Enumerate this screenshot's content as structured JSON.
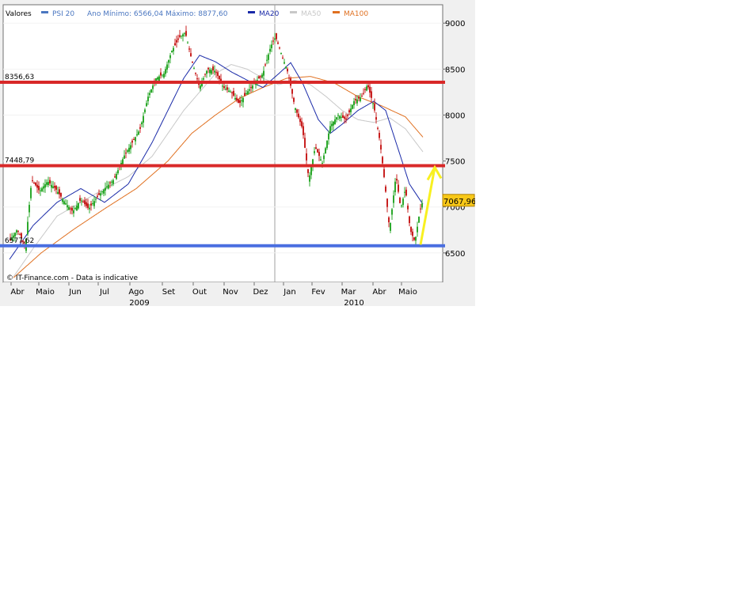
{
  "chart_data": {
    "type": "candlestick",
    "legend": {
      "values_label": "Valores",
      "items": [
        {
          "name": "PSI 20",
          "color": "#4a76c0"
        },
        {
          "name": "Ano Mínimo: 6566,04 Máximo: 8877,60",
          "color": null
        },
        {
          "name": "MA20",
          "color": "#1a2aa8"
        },
        {
          "name": "MA50",
          "color": "#c8c8c8"
        },
        {
          "name": "MA100",
          "color": "#e07020"
        }
      ]
    },
    "x_ticks": [
      "Abr",
      "Maio",
      "Jun",
      "Jul",
      "Ago",
      "Set",
      "Out",
      "Nov",
      "Dez",
      "Jan",
      "Fev",
      "Mar",
      "Abr",
      "Maio"
    ],
    "years": [
      "2009",
      "2010"
    ],
    "y_ticks": [
      6500,
      7000,
      7500,
      8000,
      8500,
      9000
    ],
    "y_range": [
      6180,
      9200
    ],
    "current_value_label": "7067,96",
    "current_value": 7067.96,
    "level_lines": [
      {
        "label": "8356,63",
        "value": 8356.63,
        "color": "#d82828"
      },
      {
        "label": "7448,79",
        "value": 7448.79,
        "color": "#d82828"
      },
      {
        "label": "6577,62",
        "value": 6577.62,
        "color": "#4a6ee0"
      }
    ],
    "arrow": {
      "from_value": 6590,
      "to_value": 7448.79,
      "color": "#f8f020"
    },
    "copyright": "© IT-Finance.com - Data is indicative",
    "anchors": [
      [
        0,
        6620
      ],
      [
        10,
        6760
      ],
      [
        20,
        6560
      ],
      [
        28,
        7300
      ],
      [
        38,
        7170
      ],
      [
        48,
        7280
      ],
      [
        58,
        7200
      ],
      [
        70,
        7050
      ],
      [
        80,
        6950
      ],
      [
        90,
        7080
      ],
      [
        100,
        6980
      ],
      [
        110,
        7100
      ],
      [
        120,
        7200
      ],
      [
        132,
        7300
      ],
      [
        145,
        7560
      ],
      [
        155,
        7700
      ],
      [
        165,
        7850
      ],
      [
        175,
        8200
      ],
      [
        185,
        8400
      ],
      [
        195,
        8450
      ],
      [
        205,
        8700
      ],
      [
        215,
        8850
      ],
      [
        222,
        8900
      ],
      [
        230,
        8600
      ],
      [
        240,
        8300
      ],
      [
        250,
        8500
      ],
      [
        260,
        8480
      ],
      [
        270,
        8300
      ],
      [
        280,
        8250
      ],
      [
        290,
        8120
      ],
      [
        300,
        8250
      ],
      [
        310,
        8350
      ],
      [
        320,
        8450
      ],
      [
        330,
        8750
      ],
      [
        336,
        8850
      ],
      [
        344,
        8650
      ],
      [
        352,
        8450
      ],
      [
        360,
        8100
      ],
      [
        370,
        7850
      ],
      [
        378,
        7300
      ],
      [
        386,
        7650
      ],
      [
        395,
        7480
      ],
      [
        405,
        7880
      ],
      [
        415,
        8000
      ],
      [
        425,
        7950
      ],
      [
        435,
        8150
      ],
      [
        445,
        8200
      ],
      [
        452,
        8330
      ],
      [
        460,
        8100
      ],
      [
        468,
        7700
      ],
      [
        474,
        7250
      ],
      [
        480,
        6750
      ],
      [
        488,
        7350
      ],
      [
        494,
        6980
      ],
      [
        500,
        7200
      ],
      [
        506,
        6750
      ],
      [
        512,
        6620
      ],
      [
        518,
        6950
      ],
      [
        522,
        7067.96
      ]
    ],
    "ma20": [
      [
        0,
        6430
      ],
      [
        30,
        6800
      ],
      [
        60,
        7050
      ],
      [
        90,
        7200
      ],
      [
        120,
        7050
      ],
      [
        150,
        7250
      ],
      [
        180,
        7700
      ],
      [
        200,
        8050
      ],
      [
        220,
        8400
      ],
      [
        240,
        8650
      ],
      [
        260,
        8580
      ],
      [
        280,
        8470
      ],
      [
        300,
        8380
      ],
      [
        320,
        8300
      ],
      [
        340,
        8450
      ],
      [
        355,
        8570
      ],
      [
        370,
        8350
      ],
      [
        390,
        7950
      ],
      [
        405,
        7800
      ],
      [
        420,
        7900
      ],
      [
        440,
        8050
      ],
      [
        460,
        8150
      ],
      [
        475,
        8050
      ],
      [
        490,
        7650
      ],
      [
        505,
        7250
      ],
      [
        522,
        7030
      ]
    ],
    "ma50": [
      [
        5,
        6240
      ],
      [
        30,
        6550
      ],
      [
        60,
        6900
      ],
      [
        90,
        7050
      ],
      [
        120,
        7200
      ],
      [
        150,
        7330
      ],
      [
        180,
        7550
      ],
      [
        200,
        7800
      ],
      [
        220,
        8050
      ],
      [
        240,
        8250
      ],
      [
        260,
        8450
      ],
      [
        280,
        8550
      ],
      [
        300,
        8500
      ],
      [
        320,
        8400
      ],
      [
        340,
        8330
      ],
      [
        360,
        8380
      ],
      [
        380,
        8330
      ],
      [
        400,
        8200
      ],
      [
        420,
        8050
      ],
      [
        440,
        7950
      ],
      [
        460,
        7920
      ],
      [
        480,
        7970
      ],
      [
        500,
        7850
      ],
      [
        522,
        7600
      ]
    ],
    "ma100": [
      [
        5,
        6230
      ],
      [
        40,
        6500
      ],
      [
        80,
        6750
      ],
      [
        120,
        6980
      ],
      [
        160,
        7200
      ],
      [
        200,
        7500
      ],
      [
        230,
        7800
      ],
      [
        260,
        8000
      ],
      [
        290,
        8180
      ],
      [
        320,
        8300
      ],
      [
        350,
        8400
      ],
      [
        380,
        8420
      ],
      [
        410,
        8350
      ],
      [
        440,
        8200
      ],
      [
        470,
        8100
      ],
      [
        500,
        7980
      ],
      [
        522,
        7760
      ]
    ]
  }
}
